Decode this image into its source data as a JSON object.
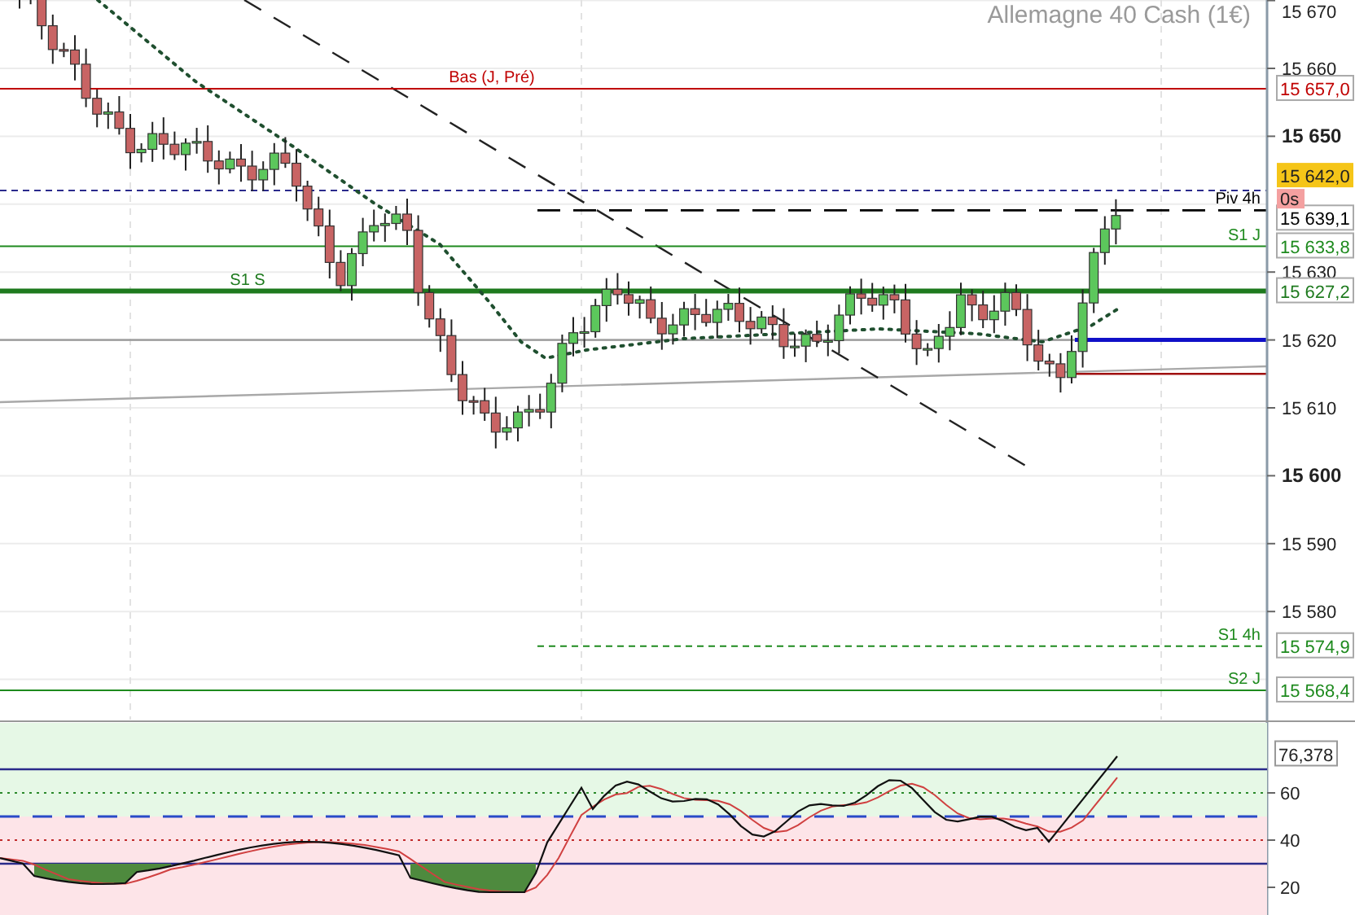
{
  "chart": {
    "title": "Allemagne 40 Cash (1€)",
    "axis_labels": [
      {
        "text": "15 670",
        "major": false
      },
      {
        "text": "15 660",
        "major": false
      },
      {
        "text": "15 650",
        "major": true
      },
      {
        "text": "15 630",
        "major": false
      },
      {
        "text": "15 620",
        "major": false
      },
      {
        "text": "15 610",
        "major": false
      },
      {
        "text": "15 600",
        "major": true
      },
      {
        "text": "15 590",
        "major": false
      },
      {
        "text": "15 580",
        "major": false
      }
    ],
    "levels": [
      {
        "label": "Bas (J, Pré)",
        "tag": "15 657,0",
        "kind": "prior-low",
        "color": "#c00000"
      },
      {
        "tag": "15 642,0",
        "kind": "price",
        "color": "#f5c518",
        "countdown": "0s"
      },
      {
        "label": "Piv 4h",
        "tag": "15 639,1",
        "kind": "pivot-4h",
        "color": "#000000"
      },
      {
        "label": "S1 J",
        "tag": "15 633,8",
        "kind": "daily",
        "color": "#1e8a1e"
      },
      {
        "label": "S1 S",
        "tag": "15 627,2",
        "kind": "weekly",
        "color": "#1e7a1e"
      },
      {
        "label": "S1 4h",
        "tag": "15 574,9",
        "kind": "support-4h",
        "color": "#1e8a1e"
      },
      {
        "label": "S2 J",
        "tag": "15 568,4",
        "kind": "daily",
        "color": "#1e8a1e"
      }
    ]
  },
  "oscillator": {
    "axis_labels": [
      "60",
      "40",
      "20"
    ],
    "tag": "76,378"
  }
}
